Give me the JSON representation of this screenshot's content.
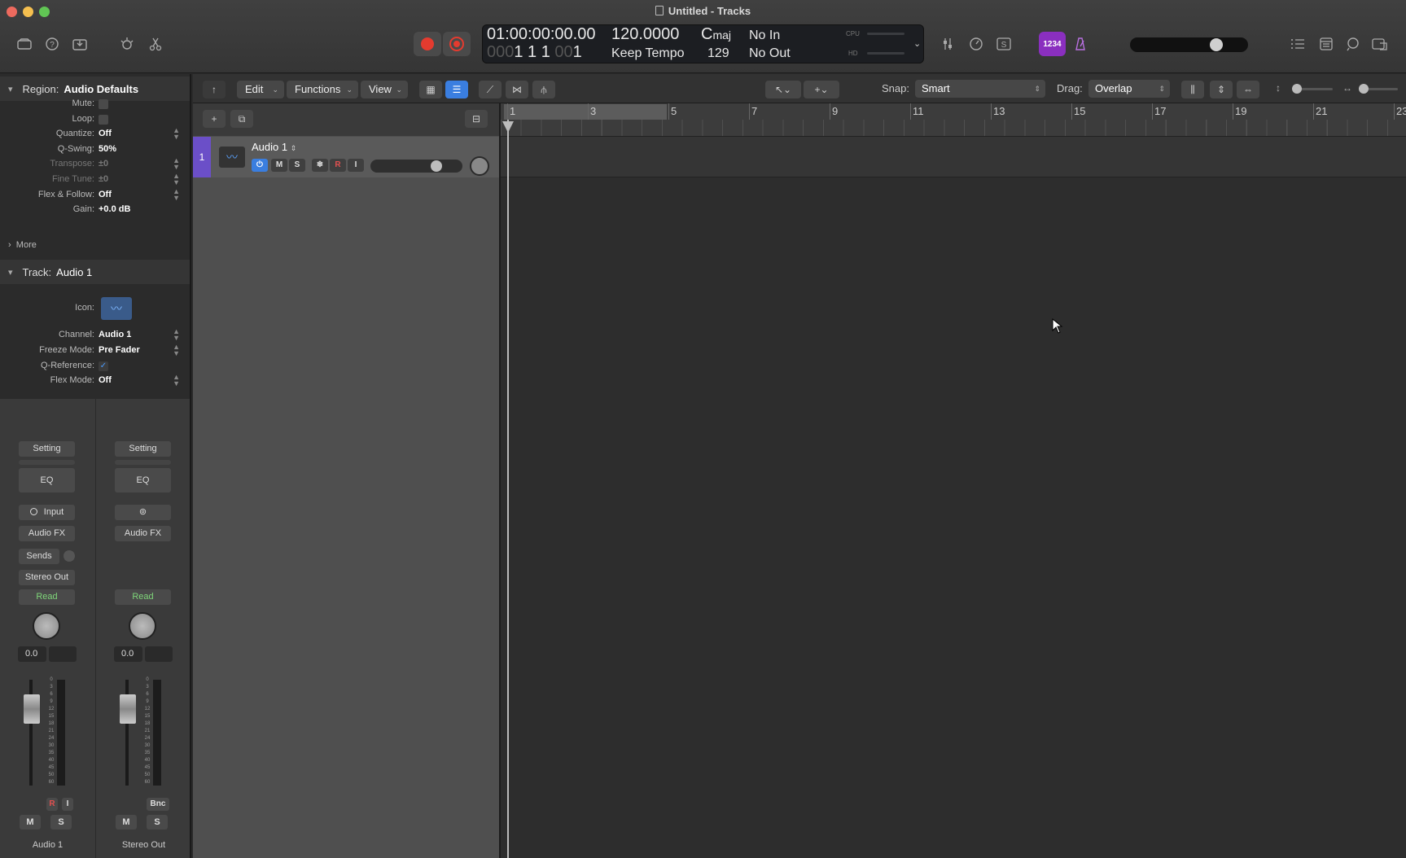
{
  "window": {
    "title": "Untitled - Tracks"
  },
  "colors": {
    "accent": "#3a7ee0",
    "record": "#e43b2f",
    "track_color": "#6b4fc8",
    "read_green": "#7fd67a",
    "badge_purple": "#8a2fbf"
  },
  "toolbar": {
    "left_icons": [
      "library-icon",
      "help-icon",
      "download-icon",
      "smart-controls-icon",
      "scissors-icon"
    ],
    "right_icons": [
      "mixer-icon",
      "tuner-icon",
      "score-icon",
      "count-in-badge",
      "metronome-icon",
      "list-editors-icon",
      "note-pad-icon",
      "loops-icon",
      "browser-icon"
    ],
    "count_in_badge": "1234"
  },
  "lcd": {
    "timecode": "01:00:00:00.00",
    "position_dim": "000",
    "position": "1 1 1",
    "position_dim2": "00",
    "position_end": "1",
    "tempo": "120.0000",
    "tempo_mode": "Keep Tempo",
    "key_root": "C",
    "key_mode": "maj",
    "signature": "129",
    "input": "No In",
    "output": "No Out",
    "cpu_label": "CPU",
    "hd_label": "HD"
  },
  "inspector": {
    "region_label": "Region:",
    "region_name": "Audio Defaults",
    "region_rows": [
      {
        "label": "Mute:",
        "value": "",
        "type": "check"
      },
      {
        "label": "Loop:",
        "value": "",
        "type": "check"
      },
      {
        "label": "Quantize:",
        "value": "Off",
        "type": "select"
      },
      {
        "label": "Q-Swing:",
        "value": "50%",
        "type": "value"
      },
      {
        "label": "Transpose:",
        "value": "±0",
        "type": "select",
        "dim": true
      },
      {
        "label": "Fine Tune:",
        "value": "±0",
        "type": "select",
        "dim": true
      },
      {
        "label": "Flex & Follow:",
        "value": "Off",
        "type": "select"
      },
      {
        "label": "Gain:",
        "value": "+0.0 dB",
        "type": "value"
      }
    ],
    "more_label": "More",
    "track_label": "Track:",
    "track_name": "Audio 1",
    "track_rows": [
      {
        "label": "Channel:",
        "value": "Audio 1",
        "type": "select"
      },
      {
        "label": "Freeze Mode:",
        "value": "Pre Fader",
        "type": "select"
      },
      {
        "label": "Q-Reference:",
        "value": "✓",
        "type": "check"
      },
      {
        "label": "Flex Mode:",
        "value": "Off",
        "type": "select"
      }
    ],
    "icon_label": "Icon:"
  },
  "strips": [
    {
      "name": "Audio 1",
      "setting": "Setting",
      "eq": "EQ",
      "input": "Input",
      "fx": "Audio FX",
      "sends": "Sends",
      "output": "Stereo Out",
      "automation": "Read",
      "value": "0.0",
      "m": "M",
      "s": "S",
      "r": "R",
      "i": "I"
    },
    {
      "name": "Stereo Out",
      "setting": "Setting",
      "eq": "EQ",
      "fx": "Audio FX",
      "automation": "Read",
      "value": "0.0",
      "m": "M",
      "s": "S",
      "bnc": "Bnc"
    }
  ],
  "fader_scale": [
    "0",
    "3",
    "6",
    "9",
    "12",
    "15",
    "18",
    "21",
    "24",
    "30",
    "35",
    "40",
    "45",
    "50",
    "60"
  ],
  "trackbar": {
    "menus": [
      "Edit",
      "Functions",
      "View"
    ],
    "snap_label": "Snap:",
    "snap_value": "Smart",
    "drag_label": "Drag:",
    "drag_value": "Overlap"
  },
  "tracks": [
    {
      "number": "1",
      "name": "Audio 1",
      "buttons": [
        "M",
        "S",
        "R",
        "I"
      ]
    }
  ],
  "ruler": {
    "bars": [
      "1",
      "3",
      "5",
      "7",
      "9",
      "11",
      "13",
      "15",
      "17",
      "19",
      "21",
      "23"
    ]
  }
}
